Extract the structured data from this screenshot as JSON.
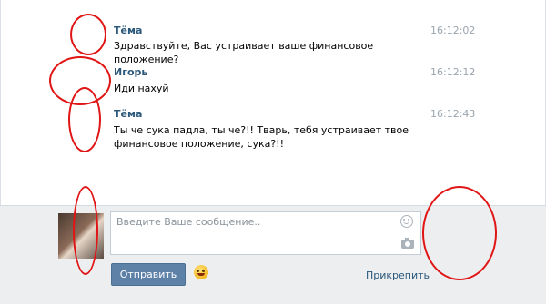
{
  "messages": [
    {
      "author": "Тёма",
      "time": "16:12:02",
      "lines": [
        "Здравствуйте, Вас устраивает ваше финансовое положение?"
      ]
    },
    {
      "author": "Игорь",
      "time": "16:12:12",
      "lines": [
        "Иди нахуй"
      ]
    },
    {
      "author": "Тёма",
      "time": "16:12:43",
      "lines": [
        "Ты че сука падла, ты че?!! Тварь, тебя устраивает твое",
        "финансовое положение, сука?!!"
      ]
    }
  ],
  "composer": {
    "placeholder": "Введите Ваше сообщение..",
    "send_label": "Отправить",
    "attach_label": "Прикрепить"
  },
  "icons": {
    "smile": "smile-icon",
    "camera": "camera-icon",
    "emoji": "emoji-icon"
  },
  "colors": {
    "author": "#2b587a",
    "send_button": "#5e81a8",
    "redaction": "#e01515"
  }
}
